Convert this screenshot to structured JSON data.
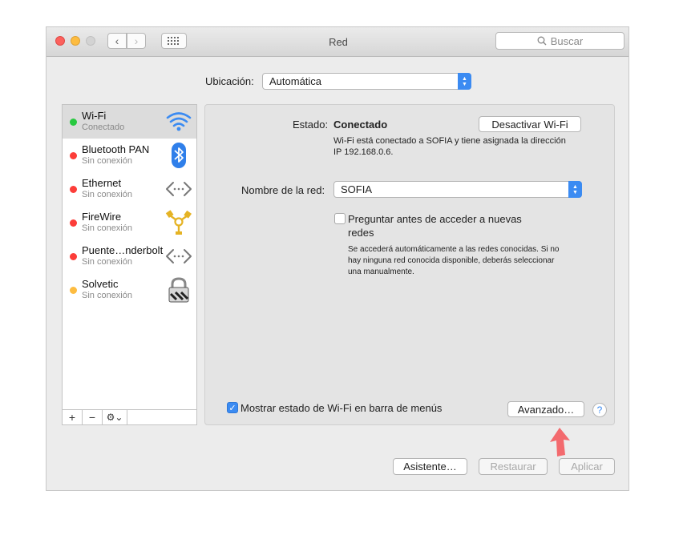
{
  "window": {
    "title": "Red"
  },
  "search": {
    "placeholder": "Buscar"
  },
  "location": {
    "label": "Ubicación:",
    "value": "Automática"
  },
  "services": [
    {
      "name": "Wi-Fi",
      "status": "Conectado",
      "status_color": "#28c940",
      "icon": "wifi-icon"
    },
    {
      "name": "Bluetooth PAN",
      "status": "Sin conexión",
      "status_color": "#fc3d39",
      "icon": "bluetooth-icon"
    },
    {
      "name": "Ethernet",
      "status": "Sin conexión",
      "status_color": "#fc3d39",
      "icon": "ethernet-icon"
    },
    {
      "name": "FireWire",
      "status": "Sin conexión",
      "status_color": "#fc3d39",
      "icon": "firewire-icon"
    },
    {
      "name": "Puente…nderbolt",
      "status": "Sin conexión",
      "status_color": "#fc3d39",
      "icon": "thunderbolt-bridge-icon"
    },
    {
      "name": "Solvetic",
      "status": "Sin conexión",
      "status_color": "#fdbc40",
      "icon": "vpn-lock-icon"
    }
  ],
  "sidebar_toolbar": {
    "add": "+",
    "remove": "−",
    "gear_menu": "⚙︎⌄"
  },
  "detail": {
    "status_label": "Estado:",
    "status_value": "Conectado",
    "toggle_wifi_button": "Desactivar Wi-Fi",
    "status_desc_line1": "Wi-Fi está conectado a SOFIA y tiene asignada la dirección",
    "status_desc_line2": "IP 192.168.0.6.",
    "network_label": "Nombre de la red:",
    "network_value": "SOFIA",
    "ask_join_line1": "Preguntar antes de acceder a nuevas",
    "ask_join_line2": "redes",
    "ask_join_checked": false,
    "ask_desc_line1": "Se accederá automáticamente a las redes conocidas. Si no",
    "ask_desc_line2": "hay ninguna red conocida disponible, deberás seleccionar",
    "ask_desc_line3": "una manualmente.",
    "show_menu_label": "Mostrar estado de Wi-Fi en barra de menús",
    "show_menu_checked": true,
    "advanced_button": "Avanzado…",
    "help": "?"
  },
  "footer": {
    "assistant_button": "Asistente…",
    "revert_button": "Restaurar",
    "apply_button": "Aplicar"
  },
  "colors": {
    "accent": "#3b8bf2",
    "annotation_arrow": "#f36a6e"
  }
}
